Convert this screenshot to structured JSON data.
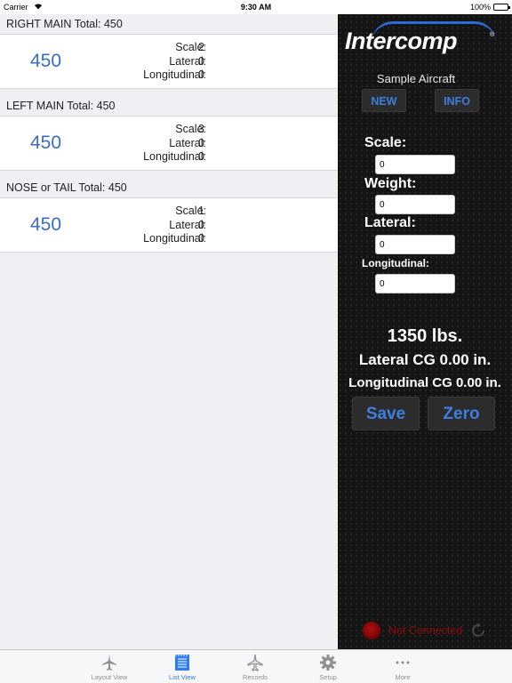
{
  "status_bar": {
    "carrier": "Carrier",
    "time": "9:30 AM",
    "battery": "100%"
  },
  "sections": [
    {
      "header": "RIGHT MAIN Total: 450",
      "total": "450",
      "scale_label": "Scale:",
      "scale": "2",
      "lateral_label": "Lateral:",
      "lateral": "0",
      "longitudinal_label": "Longitudinal:",
      "longitudinal": "0"
    },
    {
      "header": "LEFT MAIN Total: 450",
      "total": "450",
      "scale_label": "Scale:",
      "scale": "3",
      "lateral_label": "Lateral:",
      "lateral": "0",
      "longitudinal_label": "Longitudinal:",
      "longitudinal": "0"
    },
    {
      "header": "NOSE or TAIL Total: 450",
      "total": "450",
      "scale_label": "Scale:",
      "scale": "1",
      "lateral_label": "Lateral:",
      "lateral": "0",
      "longitudinal_label": "Longitudinal:",
      "longitudinal": "0"
    }
  ],
  "panel": {
    "logo": "Intercomp",
    "logo_reg": "®",
    "aircraft_name": "Sample Aircraft",
    "new_label": "NEW",
    "info_label": "INFO",
    "scale_label": "Scale:",
    "scale_value": "0",
    "weight_label": "Weight:",
    "weight_value": "0",
    "lateral_label": "Lateral:",
    "lateral_value": "0",
    "longitudinal_label": "Longitudinal:",
    "longitudinal_value": "0",
    "total_weight": "1350 lbs.",
    "lateral_cg": "Lateral CG 0.00 in.",
    "longitudinal_cg": "Longitudinal CG 0.00 in.",
    "save_label": "Save",
    "zero_label": "Zero",
    "connection_status": "Not Connected"
  },
  "tabs": [
    {
      "label": "Layout View",
      "icon": "airplane-icon"
    },
    {
      "label": "List View",
      "icon": "list-icon"
    },
    {
      "label": "Records",
      "icon": "airplane-records-icon"
    },
    {
      "label": "Setup",
      "icon": "gear-icon"
    },
    {
      "label": "More",
      "icon": "more-icon"
    }
  ],
  "active_tab": "List View",
  "colors": {
    "accent": "#3b6bc7",
    "button_text": "#3d7fe0",
    "tab_active": "#2e7cf6",
    "disconnected": "#8e0e0e"
  }
}
